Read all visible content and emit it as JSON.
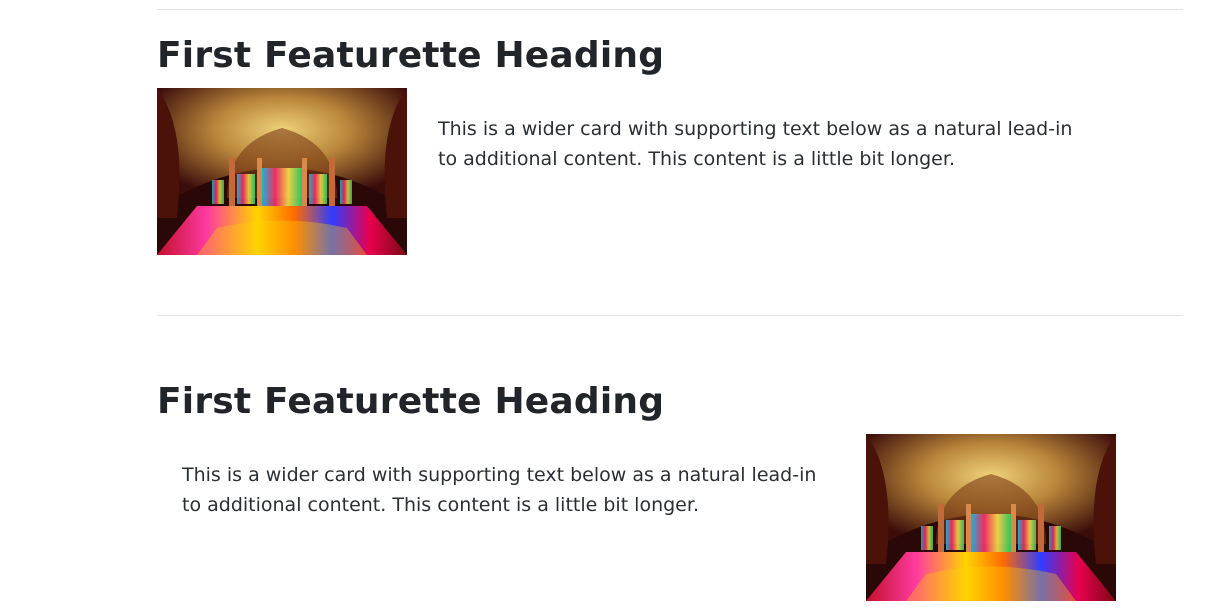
{
  "featurettes": [
    {
      "heading": "First Featurette Heading",
      "text": "This is a wider card with supporting text below as a natural lead-in to additional content. This content is a little bit longer.",
      "image_position": "left"
    },
    {
      "heading": "First Featurette Heading",
      "text": "This is a wider card with supporting text below as a natural lead-in to additional content. This content is a little bit longer.",
      "image_position": "right"
    }
  ],
  "colors": {
    "text": "#212529",
    "divider": "#e2e4e6"
  }
}
